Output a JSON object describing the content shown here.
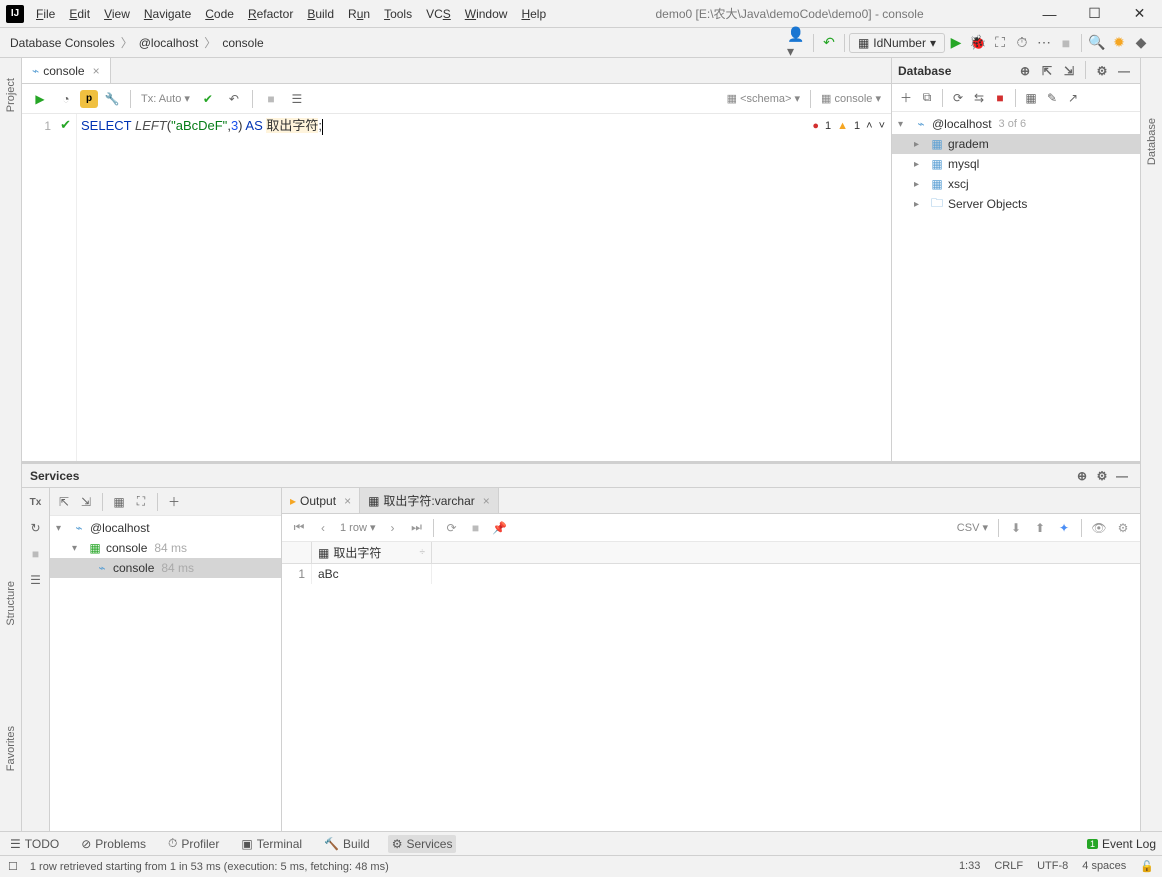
{
  "app": {
    "title": "demo0 [E:\\农大\\Java\\demoCode\\demo0] - console",
    "menu": [
      "File",
      "Edit",
      "View",
      "Navigate",
      "Code",
      "Refactor",
      "Build",
      "Run",
      "Tools",
      "VCS",
      "Window",
      "Help"
    ]
  },
  "breadcrumb": {
    "a": "Database Consoles",
    "b": "@localhost",
    "c": "console"
  },
  "runcfg": {
    "label": "IdNumber"
  },
  "editor": {
    "tab": "console",
    "txauto": "Tx: Auto",
    "schema": "<schema>",
    "console": "console",
    "line_no": "1",
    "code": {
      "select": "SELECT",
      "left": "LEFT",
      "open": "(",
      "str": "\"aBcDeF\"",
      "comma": ",",
      "num": "3",
      "close": ")",
      "as": "AS",
      "ident": "取出字符",
      "semi": ";"
    },
    "err_count": "1",
    "warn_count": "1"
  },
  "database": {
    "title": "Database",
    "root": "@localhost",
    "root_count": "3 of 6",
    "items": [
      {
        "label": "gradem",
        "selected": true
      },
      {
        "label": "mysql",
        "selected": false
      },
      {
        "label": "xscj",
        "selected": false
      },
      {
        "label": "Server Objects",
        "selected": false,
        "icon": "folder"
      }
    ]
  },
  "services": {
    "title": "Services",
    "tree": {
      "host": "@localhost",
      "console": "console",
      "time": "84 ms",
      "leaf": "console",
      "leaf_time": "84 ms"
    },
    "tabs": {
      "output": "Output",
      "result": "取出字符:varchar"
    },
    "rows_label": "1 row",
    "csv": "CSV",
    "table": {
      "header": "取出字符",
      "rownum": "1",
      "value": "aBc"
    }
  },
  "bottom_tabs": {
    "todo": "TODO",
    "problems": "Problems",
    "profiler": "Profiler",
    "terminal": "Terminal",
    "build": "Build",
    "services": "Services",
    "eventlog": "Event Log",
    "badge": "1"
  },
  "rails": {
    "project": "Project",
    "structure": "Structure",
    "favorites": "Favorites",
    "database": "Database"
  },
  "statusbar": {
    "msg": "1 row retrieved starting from 1 in 53 ms (execution: 5 ms, fetching: 48 ms)",
    "pos": "1:33",
    "eol": "CRLF",
    "enc": "UTF-8",
    "indent": "4 spaces"
  },
  "tx_label": "Tx"
}
